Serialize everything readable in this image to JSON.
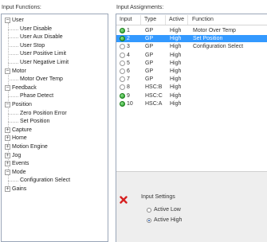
{
  "functions_panel": {
    "title": "Input Functions:",
    "tree": [
      {
        "label": "User",
        "expander": "−"
      },
      {
        "label": "User Disable"
      },
      {
        "label": "User Aux Disable"
      },
      {
        "label": "User Stop"
      },
      {
        "label": "User Positive Limit"
      },
      {
        "label": "User Negative Limit"
      },
      {
        "label": "Motor",
        "expander": "−"
      },
      {
        "label": "Motor Over Temp"
      },
      {
        "label": "Feedback",
        "expander": "−"
      },
      {
        "label": "Phase Detect"
      },
      {
        "label": "Position",
        "expander": "−"
      },
      {
        "label": "Zero Position Error"
      },
      {
        "label": "Set Position"
      },
      {
        "label": "Capture",
        "expander": "+"
      },
      {
        "label": "Home",
        "expander": "+"
      },
      {
        "label": "Motion Engine",
        "expander": "+"
      },
      {
        "label": "Jog",
        "expander": "+"
      },
      {
        "label": "Events",
        "expander": "+"
      },
      {
        "label": "Mode",
        "expander": "−"
      },
      {
        "label": "Configuration Select"
      },
      {
        "label": "Gains",
        "expander": "+"
      }
    ]
  },
  "assignments_panel": {
    "title": "Input Assignments:",
    "columns": [
      "Input",
      "Type",
      "Active",
      "Function"
    ],
    "rows": [
      {
        "input": "1",
        "led": "on",
        "type": "GP",
        "active": "High",
        "function": "Motor Over Temp"
      },
      {
        "input": "2",
        "led": "on",
        "type": "GP",
        "active": "High",
        "function": "Set Position",
        "selected": true
      },
      {
        "input": "3",
        "led": "off",
        "type": "GP",
        "active": "High",
        "function": "Configuration Select"
      },
      {
        "input": "4",
        "led": "off",
        "type": "GP",
        "active": "High",
        "function": ""
      },
      {
        "input": "5",
        "led": "off",
        "type": "GP",
        "active": "High",
        "function": ""
      },
      {
        "input": "6",
        "led": "off",
        "type": "GP",
        "active": "High",
        "function": ""
      },
      {
        "input": "7",
        "led": "off",
        "type": "GP",
        "active": "High",
        "function": ""
      },
      {
        "input": "8",
        "led": "off",
        "type": "HSC:B",
        "active": "High",
        "function": ""
      },
      {
        "input": "9",
        "led": "on",
        "type": "HSC:C",
        "active": "High",
        "function": ""
      },
      {
        "input": "10",
        "led": "on",
        "type": "HSC:A",
        "active": "High",
        "function": ""
      }
    ],
    "settings": {
      "title": "Input Settings",
      "options": [
        {
          "label": "Active Low",
          "checked": false
        },
        {
          "label": "Active High",
          "checked": true
        }
      ]
    },
    "remove_icon": "red-x-icon"
  },
  "colors": {
    "selection": "#3399ff",
    "led_on": "#1e9a1e",
    "remove_icon": "#d62020",
    "border": "#9aa6b8"
  }
}
